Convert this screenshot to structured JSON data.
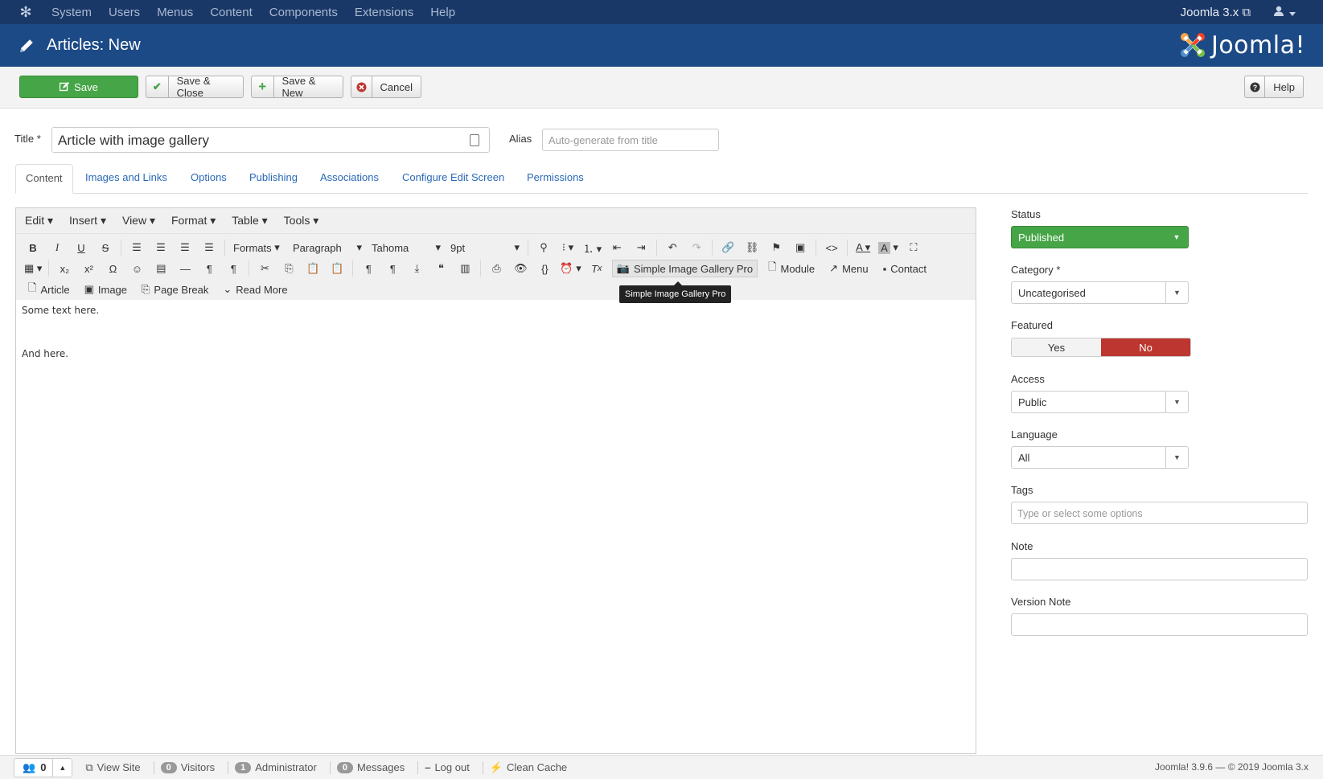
{
  "topnav": {
    "items": [
      "System",
      "Users",
      "Menus",
      "Content",
      "Components",
      "Extensions",
      "Help"
    ],
    "site_link": "Joomla 3.x"
  },
  "header": {
    "title": "Articles: New",
    "brand": "Joomla!"
  },
  "toolbar": {
    "save": "Save",
    "save_close": "Save & Close",
    "save_new": "Save & New",
    "cancel": "Cancel",
    "help": "Help"
  },
  "form": {
    "title_label": "Title *",
    "title_value": "Article with image gallery",
    "alias_label": "Alias",
    "alias_placeholder": "Auto-generate from title"
  },
  "tabs": [
    "Content",
    "Images and Links",
    "Options",
    "Publishing",
    "Associations",
    "Configure Edit Screen",
    "Permissions"
  ],
  "editor": {
    "menus": [
      "Edit",
      "Insert",
      "View",
      "Format",
      "Table",
      "Tools"
    ],
    "formats": "Formats",
    "block": "Paragraph",
    "font": "Tahoma",
    "size": "9pt",
    "buttons": {
      "sigpro": "Simple Image Gallery Pro",
      "module": "Module",
      "menu": "Menu",
      "contact": "Contact",
      "article": "Article",
      "image": "Image",
      "page_break": "Page Break",
      "read_more": "Read More"
    },
    "tooltip": "Simple Image Gallery Pro",
    "paragraphs": [
      "Some text here.",
      "And here."
    ]
  },
  "sidebar": {
    "status_label": "Status",
    "status_value": "Published",
    "category_label": "Category *",
    "category_value": "Uncategorised",
    "featured_label": "Featured",
    "featured_yes": "Yes",
    "featured_no": "No",
    "access_label": "Access",
    "access_value": "Public",
    "language_label": "Language",
    "language_value": "All",
    "tags_label": "Tags",
    "tags_placeholder": "Type or select some options",
    "note_label": "Note",
    "version_note_label": "Version Note"
  },
  "statusbar": {
    "users_count": "0",
    "view_site": "View Site",
    "visitors_count": "0",
    "visitors": "Visitors",
    "admin_count": "1",
    "administrator": "Administrator",
    "messages_count": "0",
    "messages": "Messages",
    "logout": "Log out",
    "clean_cache": "Clean Cache",
    "version": "Joomla! 3.9.6  —  © 2019 Joomla 3.x"
  },
  "colors": {
    "topnav": "#1a3867",
    "titlebar": "#1c4a86",
    "save_green": "#46a546",
    "no_red": "#bd362f",
    "link_blue": "#2a69b8"
  }
}
